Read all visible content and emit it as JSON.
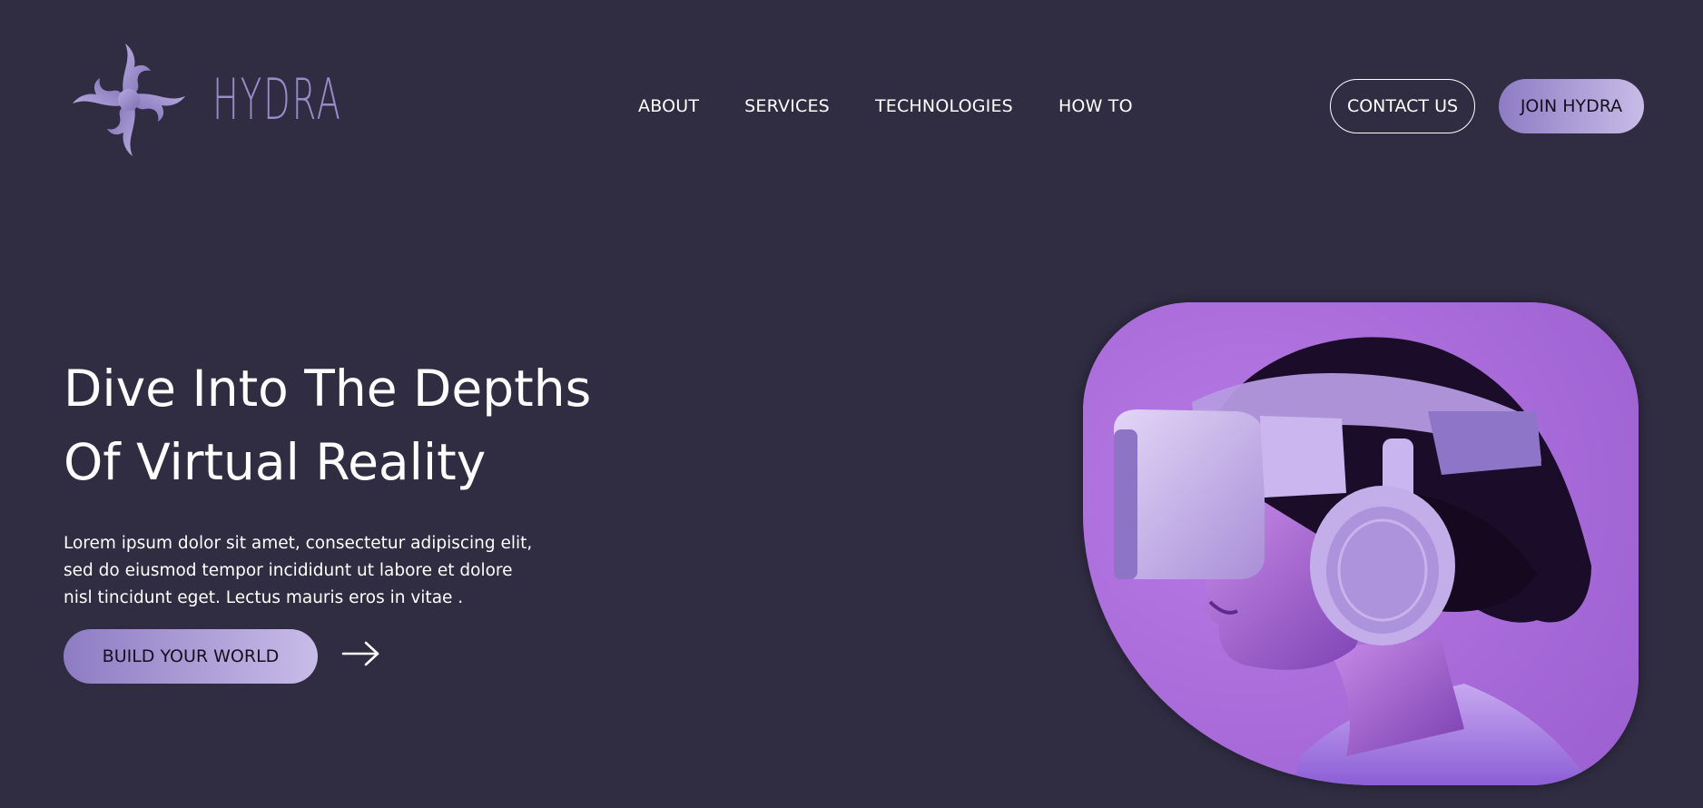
{
  "brand": {
    "name": "HYDRA",
    "logo_icon": "hydra-swirl-logo",
    "accent_color": "#9a8bc8"
  },
  "nav": {
    "items": [
      {
        "label": "ABOUT"
      },
      {
        "label": "SERVICES"
      },
      {
        "label": "TECHNOLOGIES"
      },
      {
        "label": "HOW TO"
      }
    ]
  },
  "header_actions": {
    "contact_label": "CONTACT US",
    "join_label": "JOIN HYDRA"
  },
  "hero": {
    "title_line1": "Dive Into The Depths",
    "title_line2": "Of Virtual Reality",
    "body": "Lorem ipsum dolor sit amet, consectetur adipiscing elit, sed do eiusmod tempor incididunt ut labore et dolore nisl tincidunt eget. Lectus mauris eros in vitae .",
    "cta_label": "BUILD YOUR WORLD",
    "cta_icon": "arrow-right-icon",
    "image_subject": "person-wearing-vr-headset-image"
  },
  "colors": {
    "background": "#302c42",
    "button_gradient_start": "#8e7cc3",
    "button_gradient_end": "#c8bce8",
    "image_background": "#a869d6"
  }
}
